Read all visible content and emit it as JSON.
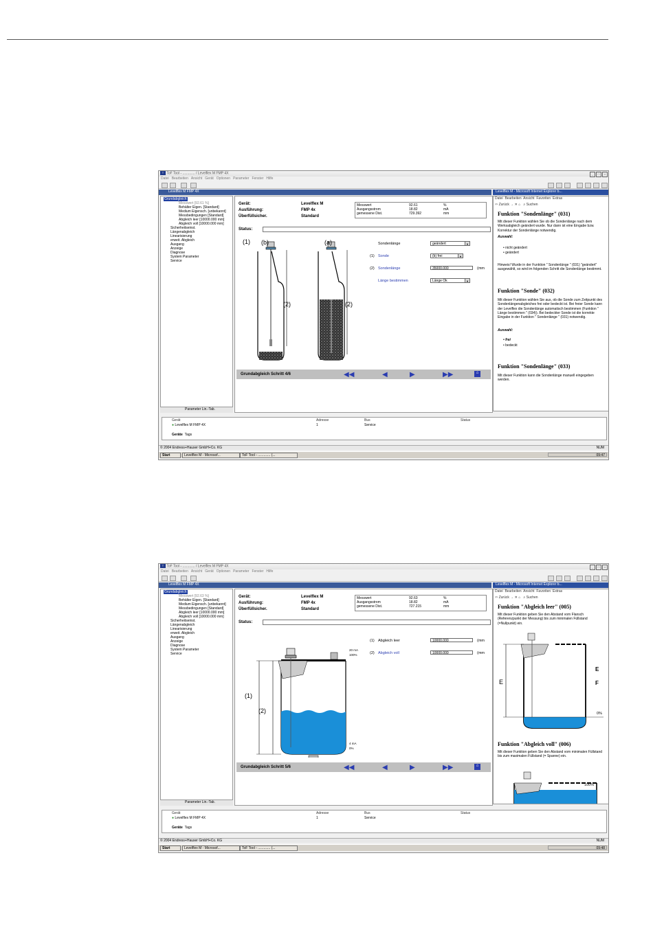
{
  "window": {
    "app_title_1": "ToF Tool - ............. / Levelflex M FMP 4X",
    "app_title_2": "ToF Tool - ............. / Levelflex M FMP 4X",
    "menu": [
      "Datei",
      "Bearbeiten",
      "Ansicht",
      "Gerät",
      "Optionen",
      "Parameter",
      "Fenster",
      "Hilfe"
    ],
    "ie_title_1": "Levelflex M - Microsoft Internet Explorer b...",
    "ie_title_2": "Levelflex M - Microsoft Internet Explorer b...",
    "ie_menu": [
      "Datei",
      "Bearbeiten",
      "Ansicht",
      "Favoriten",
      "Extras"
    ],
    "ie_back": "Zurück",
    "ie_search": "Suchen"
  },
  "tree": {
    "pane_title": "Levelflex M FMP 4X",
    "root": "Grundabgleich",
    "sub_1": [
      "Messwert [92.61 %]",
      "Behälter Eigen. [Standard]",
      "Medium Eigensch. [unbekannt]",
      "Messbedingungen [Standard]",
      "Abgleich leer [10000.000 mm]",
      "Abgleich voll [10000.000 mm]"
    ],
    "sub_2": [
      "Messwert [92.63 %]",
      "Behälter Eigen. [Standard]",
      "Medium Eigensch. [unbekannt]",
      "Messbedingungen [Standard]",
      "Abgleich leer [10000.000 mm]",
      "Abgleich voll [10000.000 mm]"
    ],
    "groups": [
      "Sicherheitseinst.",
      "Längenabgleich",
      "Linearisierung",
      "erweit. Abgleich",
      "Ausgang",
      "Anzeige",
      "Diagnose",
      "System Parameter",
      "Service"
    ],
    "tabs": [
      "Parameter",
      "Lin.-Tab."
    ]
  },
  "device": {
    "label_geraet": "Gerät:",
    "label_ausfuehrung": "Ausführung:",
    "label_ueberfuell": "Überfüllsicher.",
    "geraet": "Levelflex M",
    "ausfuehrung": "FMP 4x",
    "ueberfuell": "Standard",
    "status_label": "Status:"
  },
  "measure_1": {
    "rows": [
      {
        "name": "Messwert",
        "value": "92.61",
        "unit": "%"
      },
      {
        "name": "Ausgangsstrom",
        "value": "18.82",
        "unit": "mA"
      },
      {
        "name": "gemessene Dist.",
        "value": "729.392",
        "unit": "mm"
      }
    ]
  },
  "measure_2": {
    "rows": [
      {
        "name": "Messwert",
        "value": "92.63",
        "unit": "%"
      },
      {
        "name": "Ausgangsstrom",
        "value": "18.82",
        "unit": "mA"
      },
      {
        "name": "gemessene Dist.",
        "value": "727.215",
        "unit": "mm"
      }
    ]
  },
  "step_1": {
    "title": "Grundabgleich Schritt 4/6",
    "fig_1": "(1)",
    "fig_b": "(b)",
    "fig_a": "(a)",
    "fig_2a": "(2)",
    "fig_2b": "(2)",
    "params": {
      "sondenlaenge_label": "Sondenlänge",
      "sondenlaenge_value": "geändert",
      "sonde_num": "(1)",
      "sonde_label": "Sonde",
      "sonde_value": "(b) frei",
      "sondenlaenge2_num": "(2)",
      "sondenlaenge2_label": "Sondenlänge",
      "sondenlaenge2_value": "35000.000",
      "sondenlaenge2_unit": "(mm",
      "laenge_label": "Länge bestimmen",
      "laenge_value": "Länge Ok"
    }
  },
  "step_2": {
    "title": "Grundabgleich Schritt 5/6",
    "fig_1": "(1)",
    "fig_2": "(2)",
    "fig_20ma": "20 mA",
    "fig_100": "100%",
    "fig_4ma": "4 mA",
    "fig_0": "0%",
    "params": {
      "leer_num": "(1)",
      "leer_label": "Abgleich leer",
      "leer_value": "10000.000",
      "leer_unit": "(mm",
      "voll_num": "(2)",
      "voll_label": "Abgleich voll",
      "voll_value": "10000.000",
      "voll_unit": "(mm"
    }
  },
  "help_1": {
    "h1": "Funktion \"Sondenlänge\" (031)",
    "p1": "Mit dieser Funktion wählen Sie ob die Sondenlänge nach dem Werksabgleich geändert wurde. Nur dann ist eine Eingabe bzw. Korrektur der Sondenlänge notwendig.",
    "auswahl": "Auswahl:",
    "opt1": "nicht geändert",
    "opt2": "geändert",
    "hinweis": "Hinweis! Wurde in der Funktion \" Sondenlänge \" (031) \"geändert\" ausgewählt, so wird im folgenden Schritt die Sondenlänge bestimmt.",
    "h2": "Funktion \"Sonde\" (032)",
    "p2": "Mit dieser Funktion wählen Sie aus, ob die Sonde zum Zeitpunkt des Sondenlängenabgleiches frei oder bedeckt ist. Bei freier Sonde kann der Levelflex die Sondenlänge automatisch bestimmen (Funktion \" Länge bestimmen \" (034)). Bei bedeckter Sonde ist die korrekte Eingabe in der Funktion \" Sondenlänge \" (031) notwendig.",
    "auswahl2": "Auswahl:",
    "opt3": "frei",
    "opt4": "bedeckt",
    "h3": "Funktion \"Sondenlänge\" (033)",
    "p3": "Mit dieser Funktion kann die Sondenlänge manuell eingegeben werden."
  },
  "help_2": {
    "h1": "Funktion \"Abgleich leer\" (005)",
    "p1": "Mit dieser Funktion geben Sie den Abstand vom Flansch (Referenzpunkt der Messung) bis zum minimalen Füllstand (=Nullpunkt) ein.",
    "fig_E": "E",
    "fig_E2": "E",
    "fig_F": "F",
    "fig_0": "0%",
    "h2": "Funktion \"Abgleich voll\" (006)",
    "p2": "Mit dieser Funktion geben Sie den Abstand vom minimalen Füllstand bis zum maximalen Füllstand (= Spanne) ein.",
    "fig_100": "100%"
  },
  "devices_table": {
    "headers": [
      "Gerät",
      "Adresse",
      "Bus",
      "Status"
    ],
    "row": {
      "name": "Levelflex M FMP 4X",
      "address": "1",
      "bus": "Service",
      "status": ""
    },
    "tabs": [
      "Geräte",
      "Tags"
    ]
  },
  "statusbar": {
    "copyright": "© 2004 Endress+Hauser GmbH+Co. KG",
    "mode": "NUM"
  },
  "taskbar": {
    "start": "Start",
    "task1": "Levelflex M - Microsof...",
    "task2_1": "ToF Tool - ............. (...",
    "task2_2": "ToF Tool - ............. (...",
    "time_1": "09:47",
    "time_2": "09:48"
  }
}
